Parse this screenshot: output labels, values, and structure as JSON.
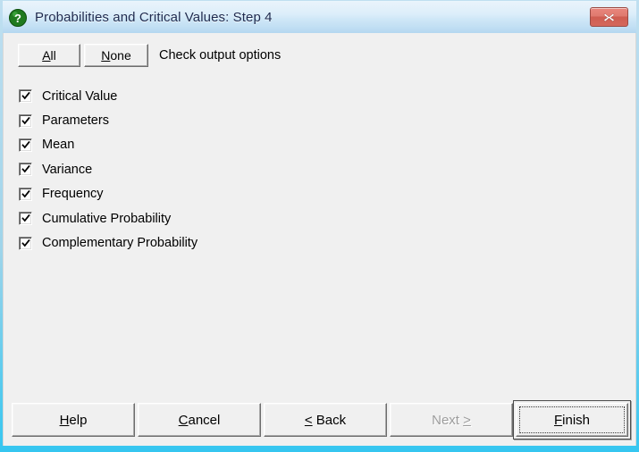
{
  "window": {
    "title": "Probabilities and Critical Values: Step 4",
    "icon": "question-mark-icon",
    "close_label": "✕",
    "accent_titlebar": "#cfe7f7",
    "accent_frame": "#35c6f0",
    "accent_close": "#d4685c",
    "background": "#f0f0f0"
  },
  "toolbar": {
    "all_button": {
      "label": "All",
      "accel_prefix": "A",
      "accel_rest": "ll"
    },
    "none_button": {
      "label": "None",
      "accel_prefix": "N",
      "accel_rest": "one"
    },
    "instruction": "Check output options"
  },
  "options": [
    {
      "label": "Critical Value",
      "checked": true
    },
    {
      "label": "Parameters",
      "checked": true
    },
    {
      "label": "Mean",
      "checked": true
    },
    {
      "label": "Variance",
      "checked": true
    },
    {
      "label": "Frequency",
      "checked": true
    },
    {
      "label": "Cumulative Probability",
      "checked": true
    },
    {
      "label": "Complementary Probability",
      "checked": true
    }
  ],
  "buttons": {
    "help": {
      "pre": "",
      "accel": "H",
      "post": "elp",
      "enabled": true
    },
    "cancel": {
      "pre": "",
      "accel": "C",
      "post": "ancel",
      "enabled": true
    },
    "back": {
      "pre": "",
      "accel": "<",
      "post": " Back",
      "enabled": true
    },
    "next": {
      "pre": "Next ",
      "accel": ">",
      "post": "",
      "enabled": false
    },
    "finish": {
      "pre": "",
      "accel": "F",
      "post": "inish",
      "enabled": true,
      "is_default": true
    }
  }
}
